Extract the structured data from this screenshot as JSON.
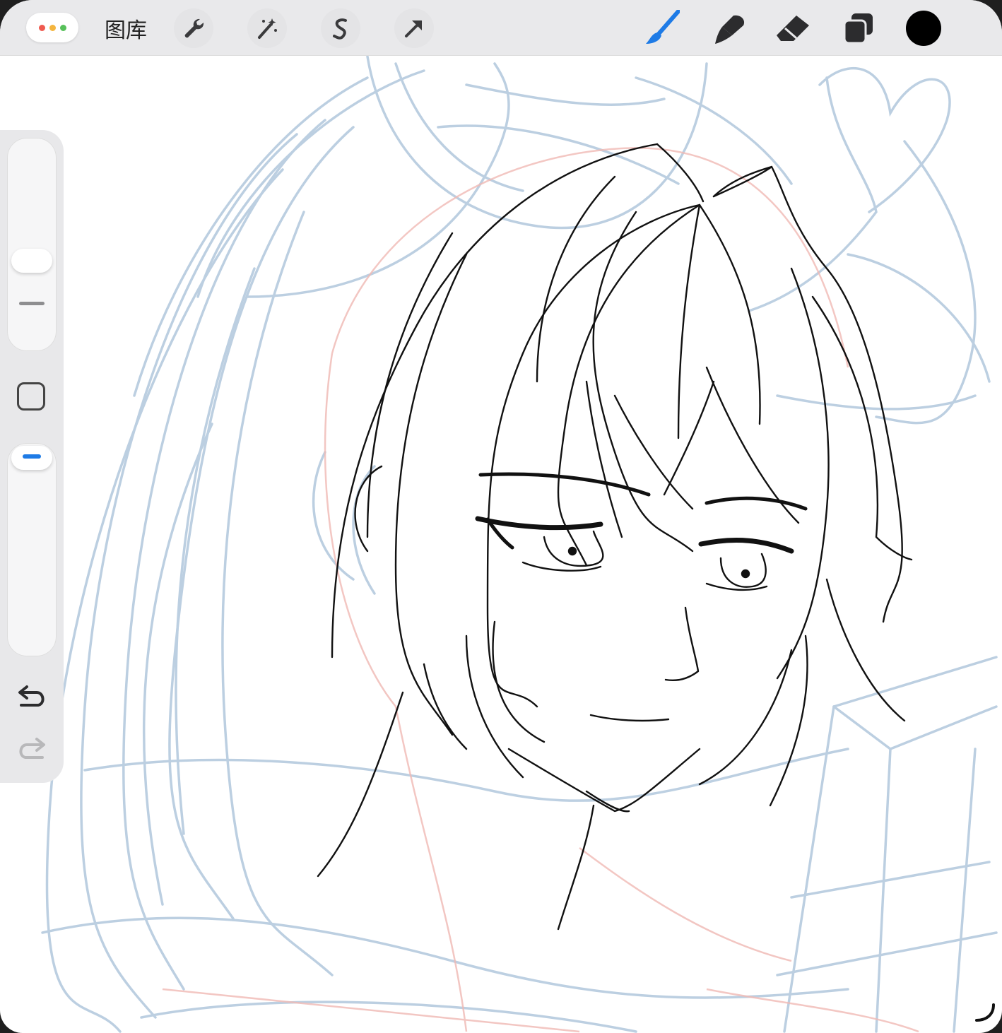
{
  "toolbar": {
    "gallery_label": "图库",
    "left_tools": [
      "wrench-icon",
      "magic-wand-icon",
      "selection-s-icon",
      "transform-arrow-icon"
    ],
    "right_tools": [
      "brush-icon",
      "smudge-icon",
      "eraser-icon",
      "layers-icon",
      "color-swatch"
    ],
    "active_tool": "brush",
    "current_color": "#000000",
    "accent_color": "#1e7be6"
  },
  "window_controls": {
    "dot_colors": [
      "#ef5a4f",
      "#f4b53f",
      "#57c05a"
    ]
  },
  "sidebar": {
    "brush_size_icon": "size-slider",
    "opacity_icon": "opacity-slider",
    "modify_icon": "square-icon",
    "undo_icon": "undo-arrow-icon",
    "redo_icon": "redo-arrow-icon"
  },
  "canvas": {
    "background": "#ffffff",
    "sketch_color": "#b9cde0",
    "underdrawing_color": "#f0b9b4",
    "lineart_color": "#111111"
  }
}
